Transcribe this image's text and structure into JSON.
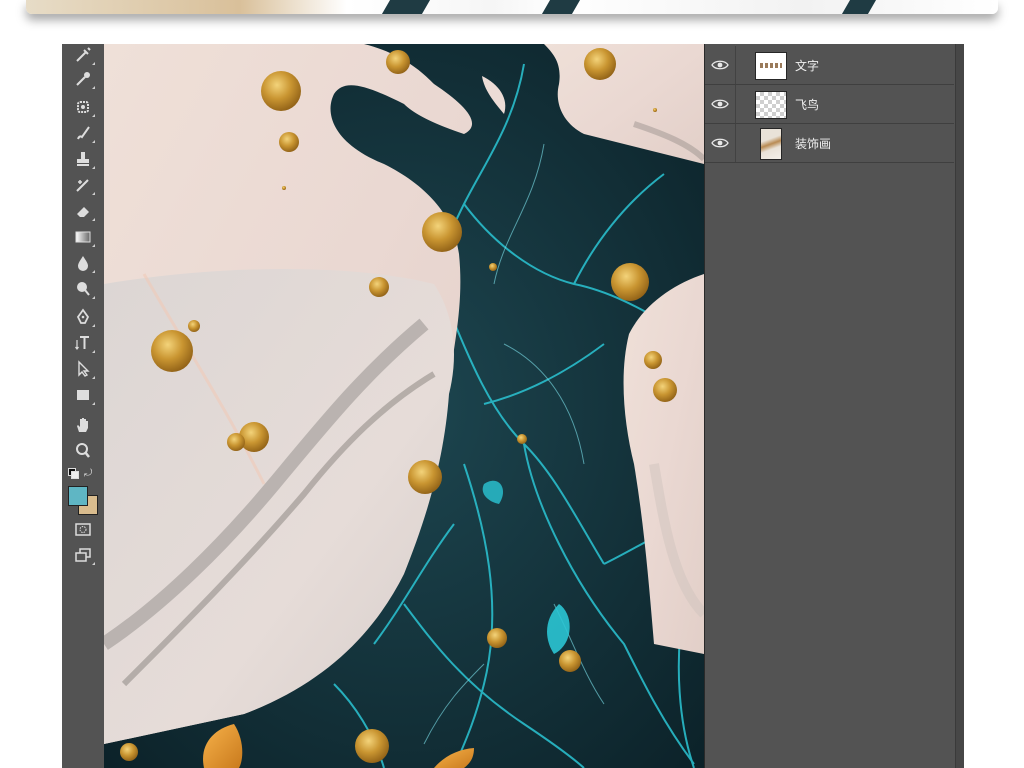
{
  "app": {
    "layers_panel": {
      "layers": [
        {
          "name": "文字",
          "visible": true,
          "thumbnail": "text-thumbnail"
        },
        {
          "name": "飞鸟",
          "visible": true,
          "thumbnail": "transparent-thumbnail"
        },
        {
          "name": "装饰画",
          "visible": true,
          "thumbnail": "artwork-thumbnail"
        }
      ]
    },
    "toolbox": {
      "tools": [
        "eyedropper-ruler-icon",
        "eyedropper-icon",
        "spot-healing-icon",
        "brush-icon",
        "clone-stamp-icon",
        "history-brush-icon",
        "eraser-icon",
        "gradient-icon",
        "blur-icon",
        "dodge-icon",
        "pen-icon",
        "type-icon",
        "path-selection-icon",
        "rectangle-icon",
        "hand-icon",
        "zoom-icon"
      ],
      "foreground_color": "#5fb6c4",
      "background_color": "#d9bc8e"
    },
    "colors": {
      "ui_background": "#535353",
      "canvas_base": "#13343d",
      "vein_cyan": "#2bc5d4",
      "pink_shape": "#ecdcd6",
      "gold": "#c9952c"
    }
  }
}
